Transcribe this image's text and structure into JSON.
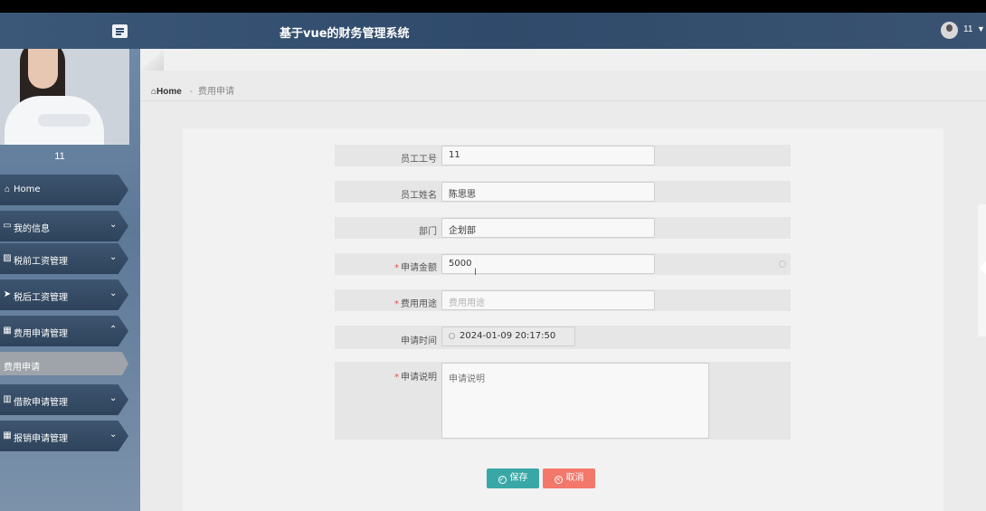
{
  "header": {
    "title": "基于vue的财务管理系统",
    "user": "11"
  },
  "sidebar": {
    "profile_name": "11",
    "items": [
      {
        "label": "Home",
        "icon": "home-icon"
      },
      {
        "label": "我的信息",
        "icon": "card-icon"
      },
      {
        "label": "税前工资管理",
        "icon": "chart-icon"
      },
      {
        "label": "税后工资管理",
        "icon": "send-icon"
      },
      {
        "label": "费用申请管理",
        "icon": "grid-icon"
      },
      {
        "label": "借款申请管理",
        "icon": "bar-icon"
      },
      {
        "label": "报销申请管理",
        "icon": "grid-icon"
      }
    ],
    "sub_item": "费用申请"
  },
  "breadcrumb": {
    "home": "Home",
    "separator": "-",
    "current": "费用申请"
  },
  "form": {
    "employee_no_label": "员工工号",
    "employee_no_value": "11",
    "employee_name_label": "员工姓名",
    "employee_name_value": "陈思思",
    "department_label": "部门",
    "department_value": "企划部",
    "amount_label": "申请金额",
    "amount_value": "5000",
    "purpose_label": "费用用途",
    "purpose_placeholder": "费用用途",
    "time_label": "申请时间",
    "time_value": "2024-01-09 20:17:50",
    "desc_label": "申请说明",
    "desc_placeholder": "申请说明",
    "required_mark": "*"
  },
  "buttons": {
    "save": "保存",
    "cancel": "取消"
  },
  "colors": {
    "topbar": "#2f4a6a",
    "save": "#3aa7a7",
    "cancel": "#f3776b",
    "required": "#e0514a"
  }
}
